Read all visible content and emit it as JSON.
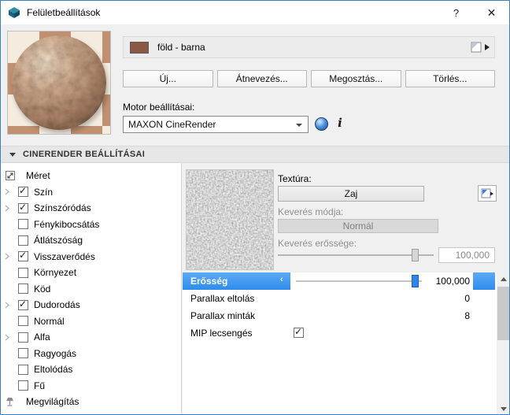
{
  "window": {
    "title": "Felületbeállítások",
    "help_label": "?",
    "close_label": "✕"
  },
  "material": {
    "name": "föld - barna",
    "swatch_color": "#8a5843"
  },
  "action_buttons": [
    {
      "label": "Új..."
    },
    {
      "label": "Átnevezés..."
    },
    {
      "label": "Megosztás..."
    },
    {
      "label": "Törlés..."
    }
  ],
  "engine": {
    "label": "Motor beállításai:",
    "value": "MAXON CineRender",
    "info_label": "i"
  },
  "section_header": {
    "label": "CINERENDER BEÁLLÍTÁSAI"
  },
  "tree": {
    "items": [
      {
        "label": "Méret",
        "icon": "size-icon",
        "checked": null,
        "expandable": false
      },
      {
        "label": "Szín",
        "checked": true,
        "expandable": true
      },
      {
        "label": "Színszóródás",
        "checked": true,
        "expandable": true
      },
      {
        "label": "Fénykibocsátás",
        "checked": false,
        "expandable": false
      },
      {
        "label": "Átlátszóság",
        "checked": false,
        "expandable": false
      },
      {
        "label": "Visszaverődés",
        "checked": true,
        "expandable": true
      },
      {
        "label": "Környezet",
        "checked": false,
        "expandable": false
      },
      {
        "label": "Köd",
        "checked": false,
        "expandable": false
      },
      {
        "label": "Dudorodás",
        "checked": true,
        "expandable": true
      },
      {
        "label": "Normál",
        "checked": false,
        "expandable": false
      },
      {
        "label": "Alfa",
        "checked": false,
        "expandable": true
      },
      {
        "label": "Ragyogás",
        "checked": false,
        "expandable": false
      },
      {
        "label": "Eltolódás",
        "checked": false,
        "expandable": false
      },
      {
        "label": "Fű",
        "checked": false,
        "expandable": false
      },
      {
        "label": "Megvilágítás",
        "icon": "lamp-icon",
        "checked": null,
        "expandable": false
      }
    ]
  },
  "texture": {
    "label": "Textúra:",
    "button_label": "Zaj",
    "blend_mode_label": "Keverés módja:",
    "blend_mode_value": "Normál",
    "blend_strength_label": "Keverés erőssége:",
    "blend_strength_value": "100,000"
  },
  "properties": [
    {
      "label": "Erősség",
      "value": "100,000",
      "selected": true
    },
    {
      "label": "Parallax eltolás",
      "value": "0",
      "selected": false
    },
    {
      "label": "Parallax minták",
      "value": "8",
      "selected": false
    },
    {
      "label": "MIP lecsengés",
      "checked": true,
      "selected": false
    }
  ],
  "colors": {
    "selection_blue": "#3d9bf5",
    "titlebar_border": "#3e7fc1"
  }
}
